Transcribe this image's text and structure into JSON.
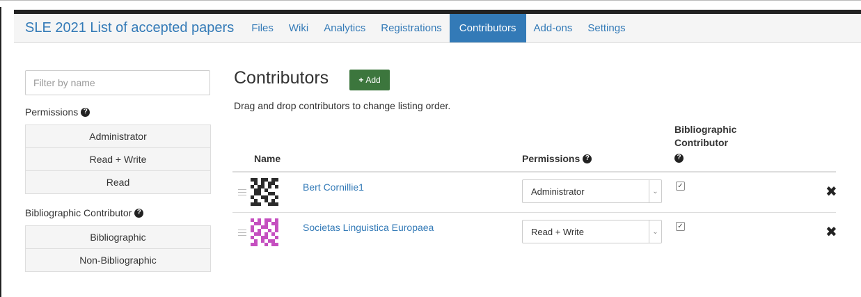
{
  "navbar": {
    "title": "SLE 2021 List of accepted papers",
    "links": [
      "Files",
      "Wiki",
      "Analytics",
      "Registrations",
      "Contributors",
      "Add-ons",
      "Settings"
    ],
    "active": "Contributors"
  },
  "sidebar": {
    "filter_placeholder": "Filter by name",
    "permissions_label": "Permissions",
    "permissions_options": [
      "Administrator",
      "Read + Write",
      "Read"
    ],
    "bibliographic_label": "Bibliographic Contributor",
    "bibliographic_options": [
      "Bibliographic",
      "Non-Bibliographic"
    ]
  },
  "main": {
    "title": "Contributors",
    "add_label": "Add",
    "help_text": "Drag and drop contributors to change listing order.",
    "columns": {
      "name": "Name",
      "permissions": "Permissions",
      "bibliographic": "Bibliographic Contributor"
    },
    "contributors": [
      {
        "name": "Bert Cornillie1",
        "permission": "Administrator",
        "bibliographic": true,
        "avatar_color": "#2b2b2b"
      },
      {
        "name": "Societas Linguistica Europaea",
        "permission": "Read + Write",
        "bibliographic": true,
        "avatar_color": "#c54fc0"
      }
    ]
  },
  "colors": {
    "brand": "#337ab7",
    "add_button": "#3c763d",
    "navbar_bg": "#f5f5f5"
  },
  "icons": [
    "question-circle-icon",
    "plus-icon",
    "drag-handle-icon",
    "chevron-down-icon",
    "checkmark-icon",
    "remove-x-icon"
  ]
}
